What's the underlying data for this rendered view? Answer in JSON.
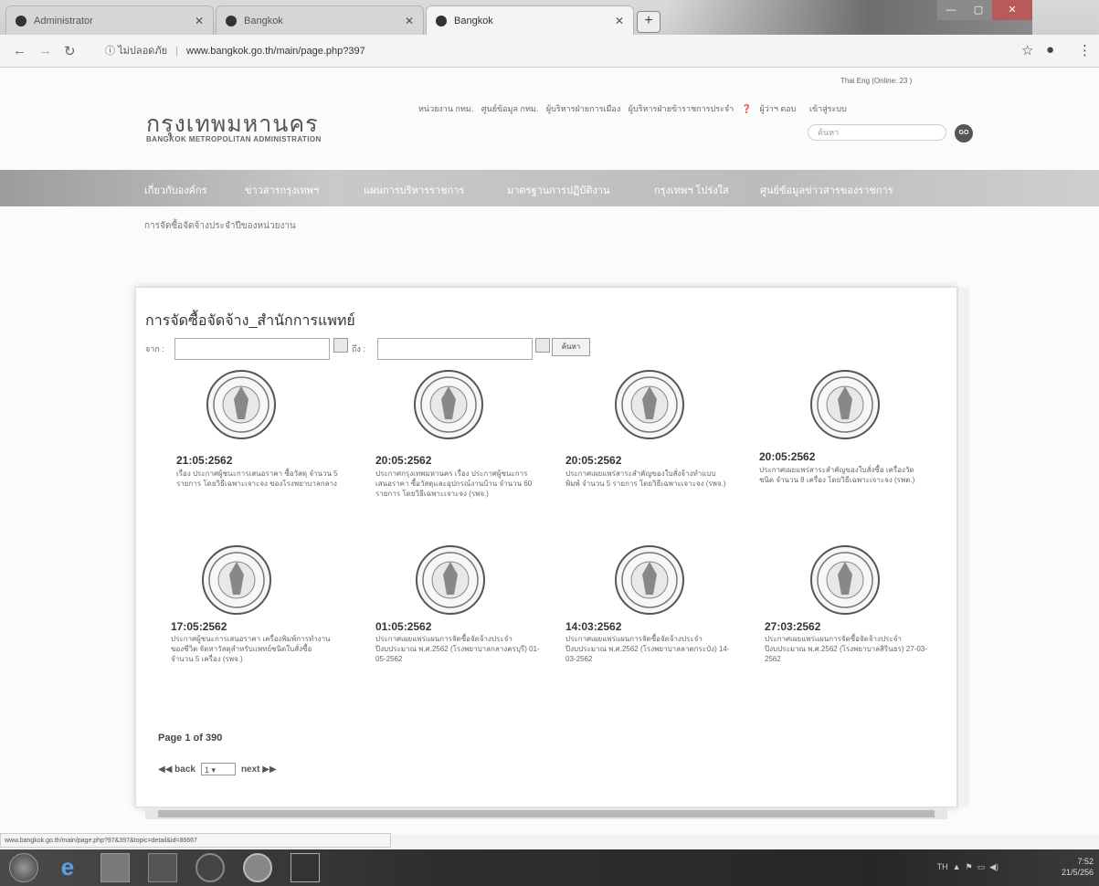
{
  "browser": {
    "tabs": [
      {
        "title": "Administrator",
        "active": false
      },
      {
        "title": "Bangkok",
        "active": false
      },
      {
        "title": "Bangkok",
        "active": true
      }
    ],
    "newtab_label": "+",
    "security_label": "ไม่ปลอดภัย",
    "url": "www.bangkok.go.th/main/page.php?397"
  },
  "header": {
    "lang_info": "Thai  Eng  (Online: 23 )",
    "logo_th": "กรุงเทพมหานคร",
    "logo_en": "BANGKOK METROPOLITAN ADMINISTRATION",
    "toplinks": [
      "หน่วยงาน กทม.",
      "ศูนย์ข้อมูล กทม.",
      "ผู้บริหารฝ่ายการเมือง",
      "ผู้บริหารฝ่ายข้าราชการประจำ",
      "ผู้ว่าฯ ตอบ",
      "เข้าสู่ระบบ"
    ],
    "search_placeholder": "ค้นหา",
    "go_label": "GO"
  },
  "nav": {
    "items": [
      "เกี่ยวกับองค์กร",
      "ข่าวสารกรุงเทพฯ",
      "แผนการบริหารราชการ",
      "มาตรฐานการปฏิบัติงาน",
      "กรุงเทพฯ โปร่งใส",
      "ศูนย์ข้อมูลข่าวสารของราชการ"
    ],
    "sub": "การจัดซื้อจัดจ้างประจำปีของหน่วยงาน"
  },
  "content": {
    "title": "การจัดซื้อจัดจ้าง_สำนักการแพทย์",
    "from_label": "จาก :",
    "to_label": "ถึง :",
    "search_button": "ค้นหา",
    "items": [
      {
        "date": "21:05:2562",
        "text": "เรื่อง ประกาศผู้ชนะการเสนอราคา ซื้อวัสดุ จำนวน 5 รายการ โดยวิธีเฉพาะเจาะจง ของโรงพยาบาลกลาง"
      },
      {
        "date": "20:05:2562",
        "text": "ประกาศกรุงเทพมหานคร เรื่อง ประกาศผู้ชนะการเสนอราคา ซื้อวัสดุและอุปกรณ์งานบ้าน จำนวน 60 รายการ โดยวิธีเฉพาะเจาะจง (รพจ.)"
      },
      {
        "date": "20:05:2562",
        "text": "ประกาศเผยแพร่สาระสำคัญของใบสั่งจ้างทำแบบพิมพ์ จำนวน 5 รายการ โดยวิธีเฉพาะเจาะจง (รพจ.)"
      },
      {
        "date": "20:05:2562",
        "text": "ประกาศเผยแพร่สาระสำคัญของใบสั่งซื้อ เครื่องวัดชนิด จำนวน 8 เครื่อง โดยวิธีเฉพาะเจาะจง (รพต.)"
      },
      {
        "date": "17:05:2562",
        "text": "ประกาศผู้ชนะการเสนอราคา เครื่องพิมพ์การทำงานของชีวิต จัดหาวัสดุสำหรับแพทย์ชนิดใบสั่งซื้อ จำนวน 5 เครื่อง (รพจ.)"
      },
      {
        "date": "01:05:2562",
        "text": "ประกาศเผยแพร่แผนการจัดซื้อจัดจ้างประจำปีงบประมาณ พ.ศ.2562 (โรงพยาบาลกลางครบุรี) 01-05-2562"
      },
      {
        "date": "14:03:2562",
        "text": "ประกาศเผยแพร่แผนการจัดซื้อจัดจ้างประจำปีงบประมาณ พ.ศ.2562 (โรงพยาบาลลาดกระบัง) 14-03-2562"
      },
      {
        "date": "27:03:2562",
        "text": "ประกาศเผยแพร่แผนการจัดซื้อจัดจ้างประจำปีงบประมาณ พ.ศ.2562 (โรงพยาบาลสิรินธร) 27-03-2562"
      }
    ],
    "page_word": "Page",
    "page_current": "1",
    "page_of": "of",
    "page_total": "390",
    "back_label": "◀◀ back",
    "next_label": "next ▶▶",
    "page_select": "1"
  },
  "status_url": "www.bangkok.go.th/main/page.php?97&397&topic=detail&id=86667",
  "taskbar": {
    "tray_text": "TH",
    "time": "7:52",
    "date": "21/5/256"
  }
}
